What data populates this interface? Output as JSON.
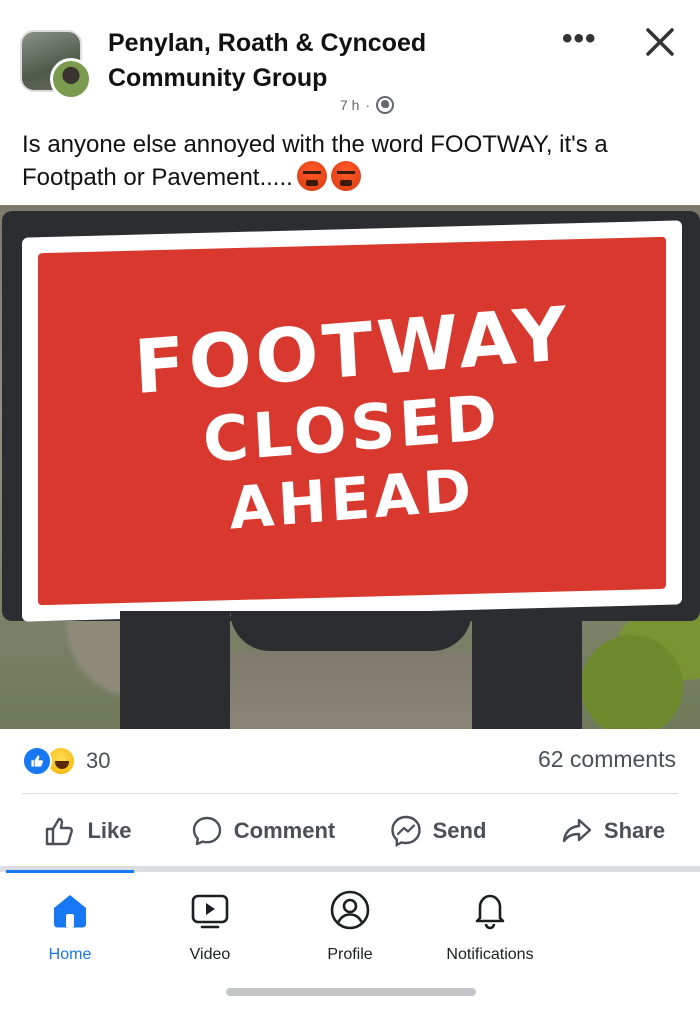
{
  "post": {
    "group_name": "Penylan, Roath & Cyncoed Community Group",
    "timestamp": "7 h",
    "caption": "Is anyone else annoyed with the word FOOTWAY, it's a Footpath or Pavement.....",
    "caption_emoji": [
      "angry-face-icon",
      "angry-face-icon"
    ],
    "more_icon": "more-options-icon",
    "close_icon": "close-icon",
    "privacy_icon": "globe-icon"
  },
  "photo": {
    "sign_lines": [
      "FOOTWAY",
      "CLOSED",
      "AHEAD"
    ],
    "sign_color": "#d8382e"
  },
  "stats": {
    "reactions": [
      "like-icon",
      "haha-icon"
    ],
    "reaction_count": "30",
    "comments": "62 comments"
  },
  "actions": [
    {
      "label": "Like",
      "icon": "thumbs-up-icon"
    },
    {
      "label": "Comment",
      "icon": "comment-icon"
    },
    {
      "label": "Send",
      "icon": "messenger-icon"
    },
    {
      "label": "Share",
      "icon": "share-icon"
    }
  ],
  "tabs": [
    {
      "label": "Home",
      "icon": "home-icon",
      "active": true
    },
    {
      "label": "Video",
      "icon": "video-icon",
      "active": false
    },
    {
      "label": "Profile",
      "icon": "profile-icon",
      "active": false
    },
    {
      "label": "Notifications",
      "icon": "bell-icon",
      "active": false
    }
  ],
  "colors": {
    "accent": "#1877f2",
    "text_secondary": "#4b4f56"
  }
}
